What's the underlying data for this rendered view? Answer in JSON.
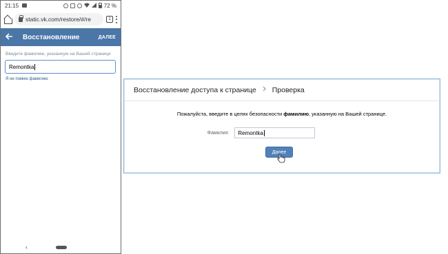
{
  "mobile": {
    "status_bar": {
      "time": "21:15",
      "battery": "72 %"
    },
    "browser": {
      "url": "static.vk.com/restore/#/re",
      "tab_count": "1"
    },
    "header": {
      "back_icon": "arrow-left-icon",
      "title": "Восстановление",
      "next_label": "ДАЛЕЕ"
    },
    "form": {
      "label": "Введите фамилию, указанную на Вашей странице",
      "value": "Remontka",
      "forgot_link": "Я не помню фамилию"
    },
    "nav": {
      "back_glyph": "‹"
    }
  },
  "desktop": {
    "breadcrumb": {
      "parent": "Восстановление доступа к странице",
      "current": "Проверка"
    },
    "description_before": "Пожалуйста, введите в целях безопасности ",
    "description_bold": "фамилию",
    "description_after": ", указанную на Вашей странице.",
    "field_label": "Фамилия:",
    "field_value": "Remontka",
    "submit_label": "Далее"
  },
  "colors": {
    "vk_blue": "#4a76a8",
    "button_blue": "#5181b8",
    "link_blue": "#2a5885"
  }
}
